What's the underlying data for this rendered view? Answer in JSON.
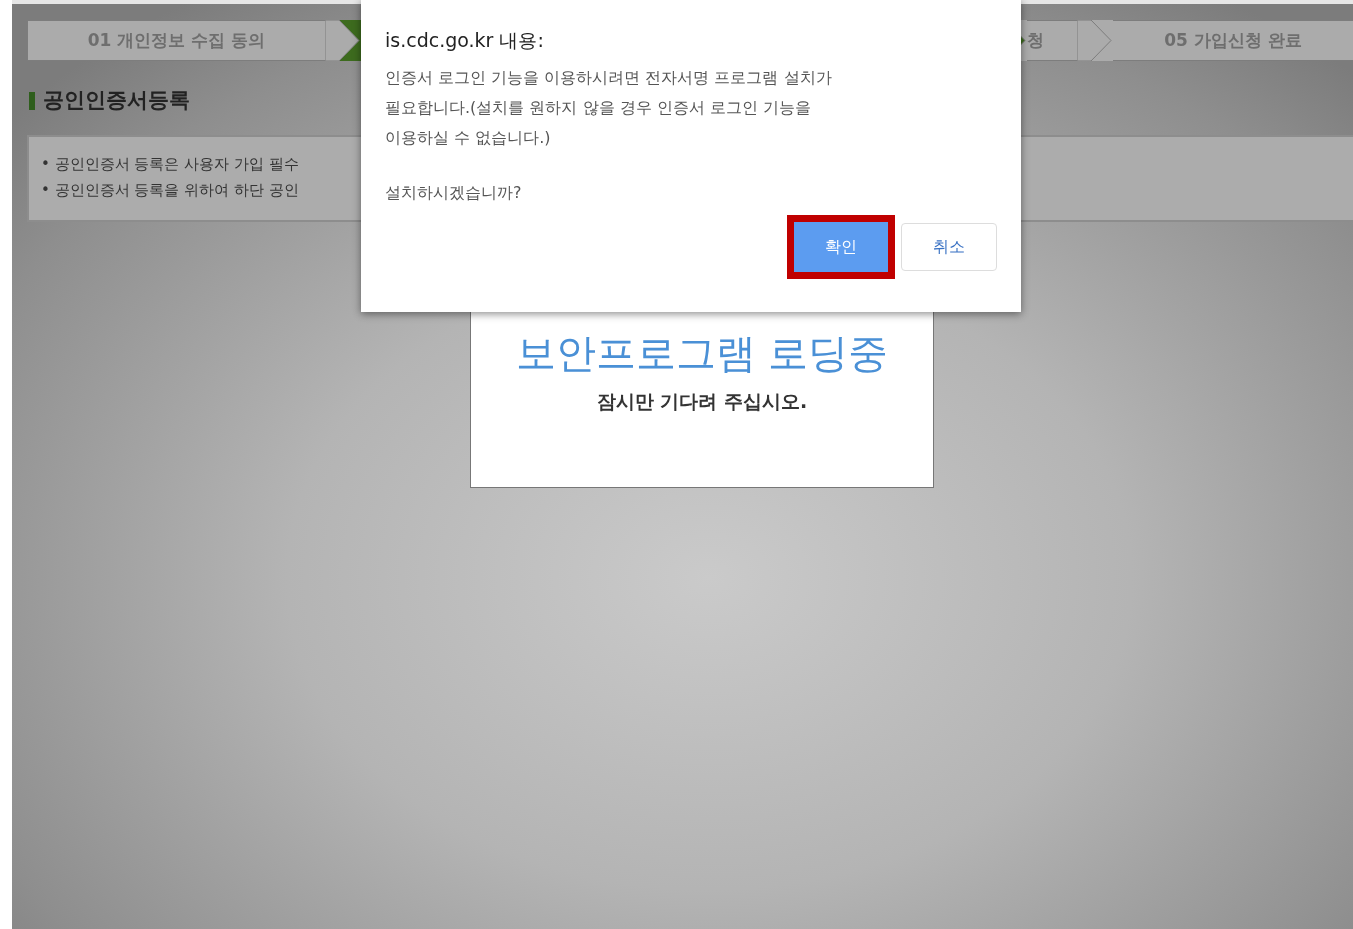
{
  "steps": [
    {
      "label": "01 개인정보 수집 동의",
      "selected": false
    },
    {
      "selected": true
    },
    {
      "label": "청",
      "selected": false
    },
    {
      "label": "05 가입신청 완료",
      "selected": false
    }
  ],
  "section": {
    "title": "공인인증서등록",
    "notes": [
      "• 공인인증서 등록은 사용자 가입 필수",
      "• 공인인증서 등록을 위하여 하단 공인"
    ]
  },
  "loading": {
    "title": "보안프로그램 로딩중",
    "subtitle": "잠시만 기다려 주십시오."
  },
  "dialog": {
    "title": "is.cdc.go.kr 내용:",
    "message_lines": [
      "인증서 로그인 기능을 이용하시려면 전자서명 프로그램 설치가",
      "필요합니다.(설치를 원하지 않을 경우 인증서 로그인 기능을",
      "이용하실 수 없습니다.)"
    ],
    "question": "설치하시겠습니까?",
    "buttons": [
      {
        "label": "확인",
        "kind": "primary",
        "highlighted": true
      },
      {
        "label": "취소",
        "kind": "secondary",
        "highlighted": false
      }
    ]
  }
}
